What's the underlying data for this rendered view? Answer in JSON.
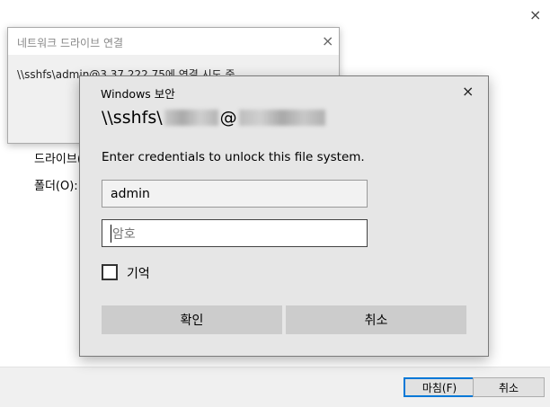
{
  "wizard": {
    "drive_label": "드라이브(",
    "folder_label": "폴더(O):",
    "finish_button": "마침(F)",
    "cancel_button": "취소",
    "close_symbol": "×"
  },
  "progress": {
    "title": "네트워크 드라이브 연결",
    "message": "\\\\sshfs\\admin@3.37.222.75에 연결 시도 중",
    "close_symbol": "×"
  },
  "credentials": {
    "title": "Windows 보안",
    "close_symbol": "×",
    "target_prefix": "\\\\sshfs\\",
    "target_at": "@",
    "prompt": "Enter credentials to unlock this file system.",
    "username_value": "admin",
    "password_placeholder": "암호",
    "remember_label": "기억",
    "ok_button": "확인",
    "cancel_button": "취소"
  }
}
